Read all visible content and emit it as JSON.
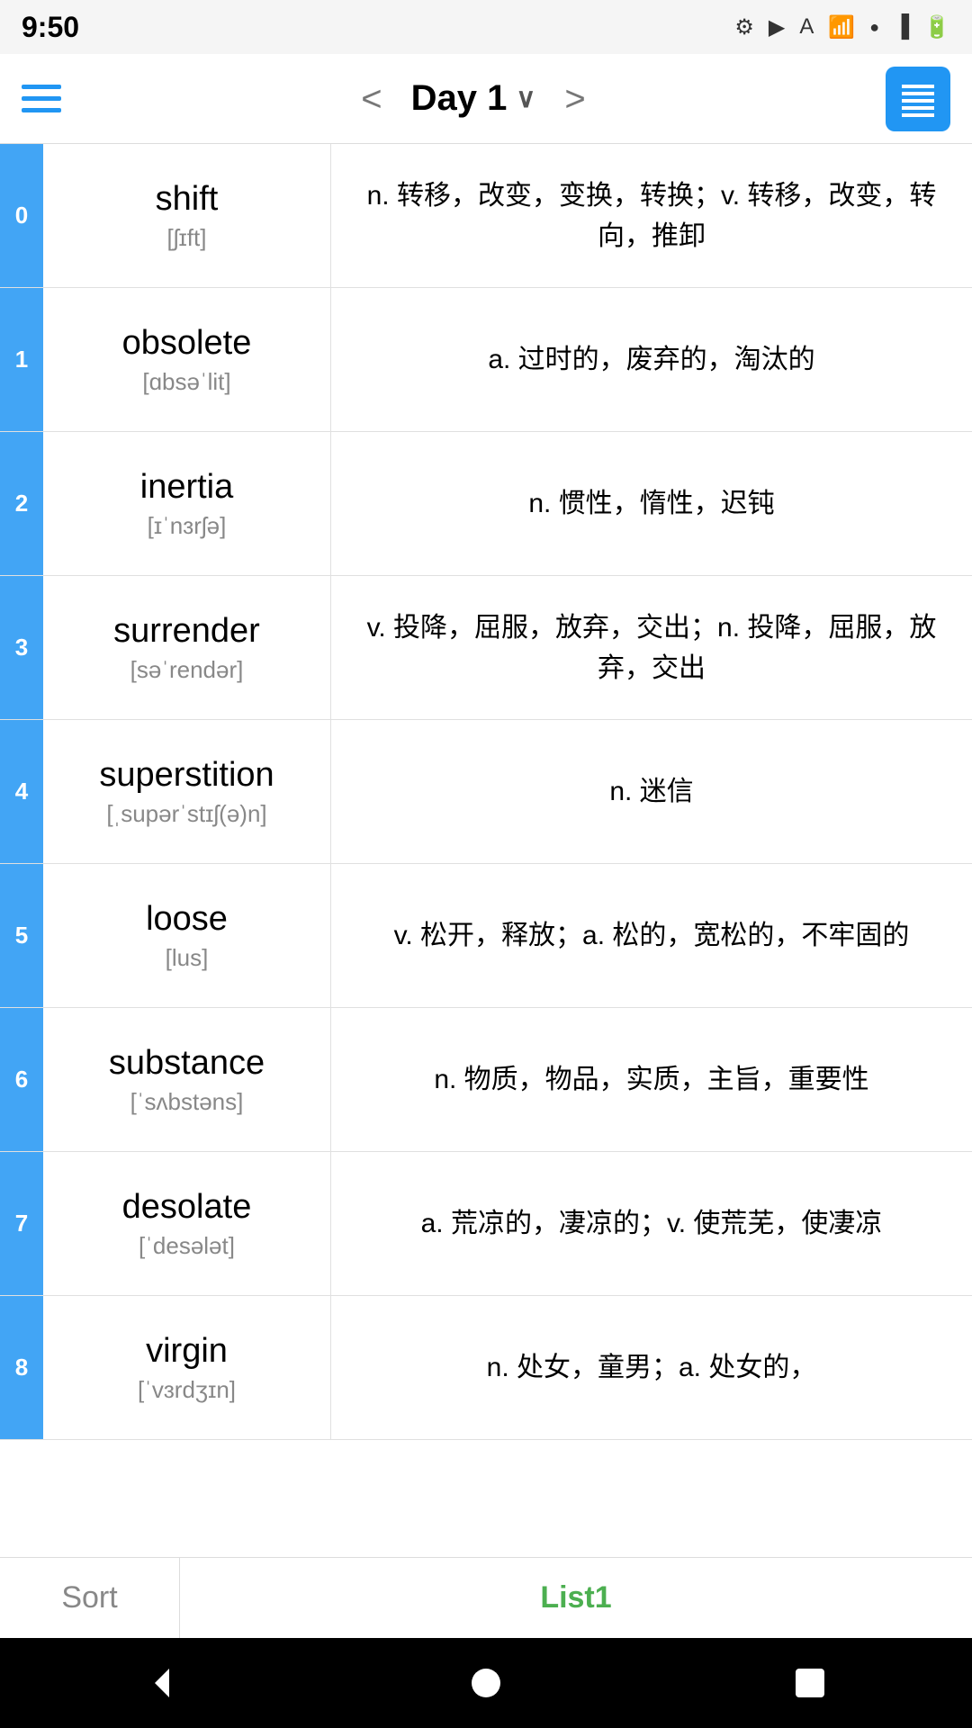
{
  "statusBar": {
    "time": "9:50",
    "icons": [
      "settings",
      "play",
      "A",
      "wifi",
      "dot",
      "signal",
      "battery"
    ]
  },
  "toolbar": {
    "menuLabel": "Menu",
    "prevLabel": "<",
    "title": "Day 1",
    "chevron": "∨",
    "nextLabel": ">",
    "listIconLabel": "List View"
  },
  "words": [
    {
      "index": "0",
      "english": "shift",
      "phonetic": "[ʃɪft]",
      "definition": "n. 转移，改变，变换，转换；v. 转移，改变，转向，推卸"
    },
    {
      "index": "1",
      "english": "obsolete",
      "phonetic": "[ɑbsəˈlit]",
      "definition": "a. 过时的，废弃的，淘汰的"
    },
    {
      "index": "2",
      "english": "inertia",
      "phonetic": "[ɪˈnɜrʃə]",
      "definition": "n. 惯性，惰性，迟钝"
    },
    {
      "index": "3",
      "english": "surrender",
      "phonetic": "[səˈrendər]",
      "definition": "v. 投降，屈服，放弃，交出；n. 投降，屈服，放弃，交出"
    },
    {
      "index": "4",
      "english": "superstition",
      "phonetic": "[ˌsupərˈstɪʃ(ə)n]",
      "definition": "n. 迷信"
    },
    {
      "index": "5",
      "english": "loose",
      "phonetic": "[lus]",
      "definition": "v. 松开，释放；a. 松的，宽松的，不牢固的"
    },
    {
      "index": "6",
      "english": "substance",
      "phonetic": "[ˈsʌbstəns]",
      "definition": "n. 物质，物品，实质，主旨，重要性"
    },
    {
      "index": "7",
      "english": "desolate",
      "phonetic": "[ˈdesələt]",
      "definition": "a. 荒凉的，凄凉的；v. 使荒芜，使凄凉"
    },
    {
      "index": "8",
      "english": "virgin",
      "phonetic": "[ˈvɜrdʒɪn]",
      "definition": "n. 处女，童男；a. 处女的，"
    }
  ],
  "bottomTabs": {
    "sort": "Sort",
    "list1": "List1"
  },
  "navBar": {
    "back": "◀",
    "home": "●",
    "recent": "■"
  }
}
